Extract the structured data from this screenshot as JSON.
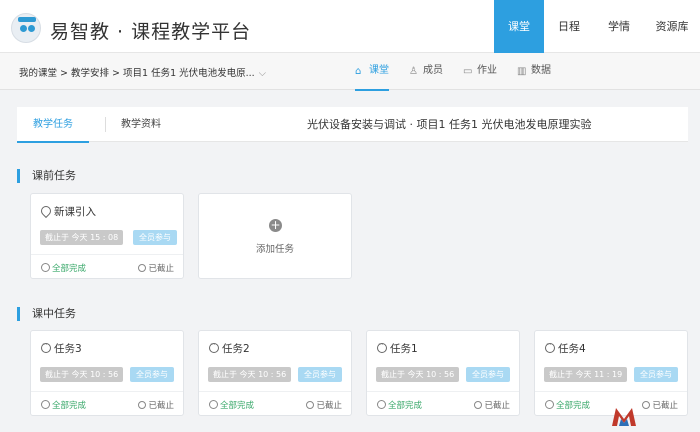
{
  "header": {
    "brand": "易智教 · 课程教学平台",
    "nav": [
      "课堂",
      "日程",
      "学情",
      "资源库"
    ],
    "active_nav": 0,
    "accent": "#2d9fe0"
  },
  "breadcrumb": {
    "text": "我的课堂 > 教学安排 > 项目1 任务1 光伏电池发电原...",
    "chevron": "⌵"
  },
  "subtabs": [
    {
      "icon": "home-icon",
      "glyph": "⌂",
      "label": "课堂"
    },
    {
      "icon": "people-icon",
      "glyph": "♙",
      "label": "成员"
    },
    {
      "icon": "document-icon",
      "glyph": "▭",
      "label": "作业"
    },
    {
      "icon": "chart-icon",
      "glyph": "▥",
      "label": "数据"
    }
  ],
  "content_tabs": {
    "tabs": [
      "教学任务",
      "教学资料"
    ],
    "title": "光伏设备安装与调试 · 项目1 任务1 光伏电池发电原理实验"
  },
  "sections": {
    "pre": {
      "heading": "课前任务",
      "cards": [
        {
          "title": "新课引入",
          "icon": "location-icon",
          "deadline": "截止于 今天 15 : 08",
          "scope": "全员参与",
          "status": "全部完成",
          "state": "已截止"
        }
      ],
      "add_label": "添加任务"
    },
    "in": {
      "heading": "课中任务",
      "cards": [
        {
          "title": "任务3",
          "icon": "chat-icon",
          "deadline": "截止于 今天 10 : 56",
          "scope": "全员参与",
          "status": "全部完成",
          "state": "已截止"
        },
        {
          "title": "任务2",
          "icon": "chat-icon",
          "deadline": "截止于 今天 10 : 56",
          "scope": "全员参与",
          "status": "全部完成",
          "state": "已截止"
        },
        {
          "title": "任务1",
          "icon": "chat-icon",
          "deadline": "截止于 今天 10 : 56",
          "scope": "全员参与",
          "status": "全部完成",
          "state": "已截止"
        },
        {
          "title": "任务4",
          "icon": "chat-icon",
          "deadline": "截止于 今天 11 : 19",
          "scope": "全员参与",
          "status": "全部完成",
          "state": "已截止"
        }
      ]
    }
  }
}
